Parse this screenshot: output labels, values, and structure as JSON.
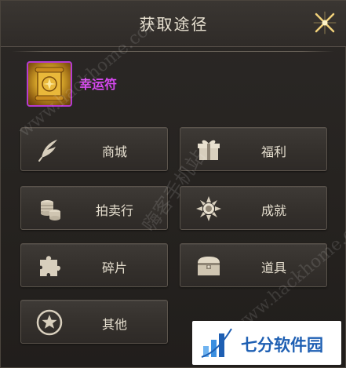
{
  "dialog": {
    "title": "获取途径"
  },
  "item": {
    "name": "幸运符",
    "rarity_color": "#b43bd1",
    "icon": "golden-scroll-icon"
  },
  "sources": [
    {
      "label": "商城",
      "icon": "feather-quill-icon"
    },
    {
      "label": "福利",
      "icon": "gift-box-icon"
    },
    {
      "label": "拍卖行",
      "icon": "coin-stack-icon"
    },
    {
      "label": "成就",
      "icon": "snowflake-medal-icon"
    },
    {
      "label": "碎片",
      "icon": "puzzle-piece-icon"
    },
    {
      "label": "道具",
      "icon": "treasure-chest-icon"
    },
    {
      "label": "其他",
      "icon": "star-circle-icon"
    }
  ],
  "watermarks": {
    "site_url": "www.hackhome.com",
    "site_name": "嗨客手机站",
    "site_url_2": "www.hackhome.com"
  },
  "branding": {
    "logo_text": "七分软件园",
    "logo_icon": "bar-chart-logo-icon"
  },
  "colors": {
    "item_name": "#d548ef",
    "label": "#e6dfcf",
    "panel": "#25221f"
  }
}
